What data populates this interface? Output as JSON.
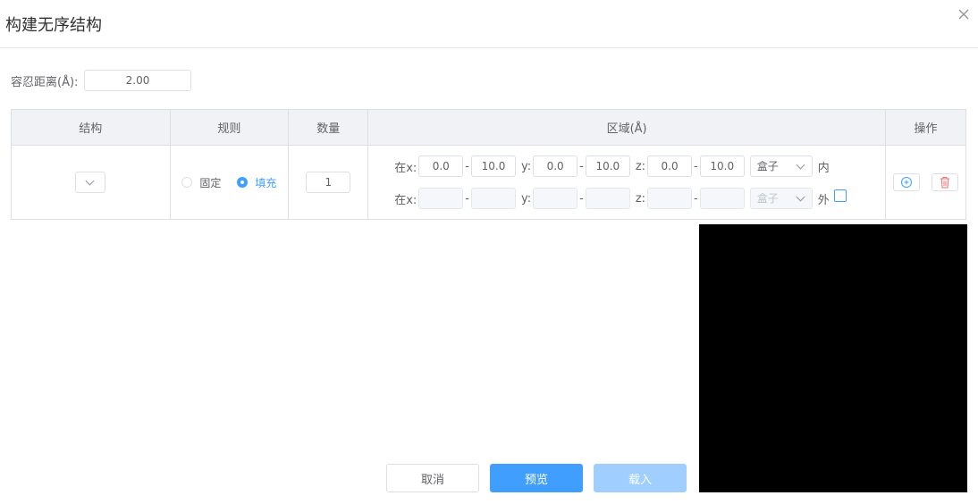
{
  "dialog": {
    "title": "构建无序结构"
  },
  "tolerance": {
    "label": "容忍距离(Å):",
    "value": "2.00"
  },
  "table": {
    "headers": {
      "structure": "结构",
      "rule": "规则",
      "count": "数量",
      "region": "区域(Å)",
      "actions": "操作"
    },
    "row": {
      "rule_options": {
        "fixed": "固定",
        "fill": "填充",
        "selected": "fill"
      },
      "count": "1",
      "region": {
        "inside": {
          "x_label": "在x:",
          "x_min": "0.0",
          "x_max": "10.0",
          "y_label": "y:",
          "y_min": "0.0",
          "y_max": "10.0",
          "z_label": "z:",
          "z_min": "0.0",
          "z_max": "10.0",
          "shape": "盒子",
          "suffix": "内"
        },
        "outside": {
          "x_label": "在x:",
          "x_min": "",
          "x_max": "",
          "y_label": "y:",
          "y_min": "",
          "y_max": "",
          "z_label": "z:",
          "z_min": "",
          "z_max": "",
          "shape": "盒子",
          "suffix": "外",
          "checked": false
        },
        "dash": "-"
      }
    }
  },
  "buttons": {
    "cancel": "取消",
    "preview": "预览",
    "load": "载入"
  },
  "colors": {
    "primary": "#409eff",
    "primary_disabled": "#a0cfff",
    "danger": "#f56c6c",
    "preview_bg": "#000000"
  }
}
